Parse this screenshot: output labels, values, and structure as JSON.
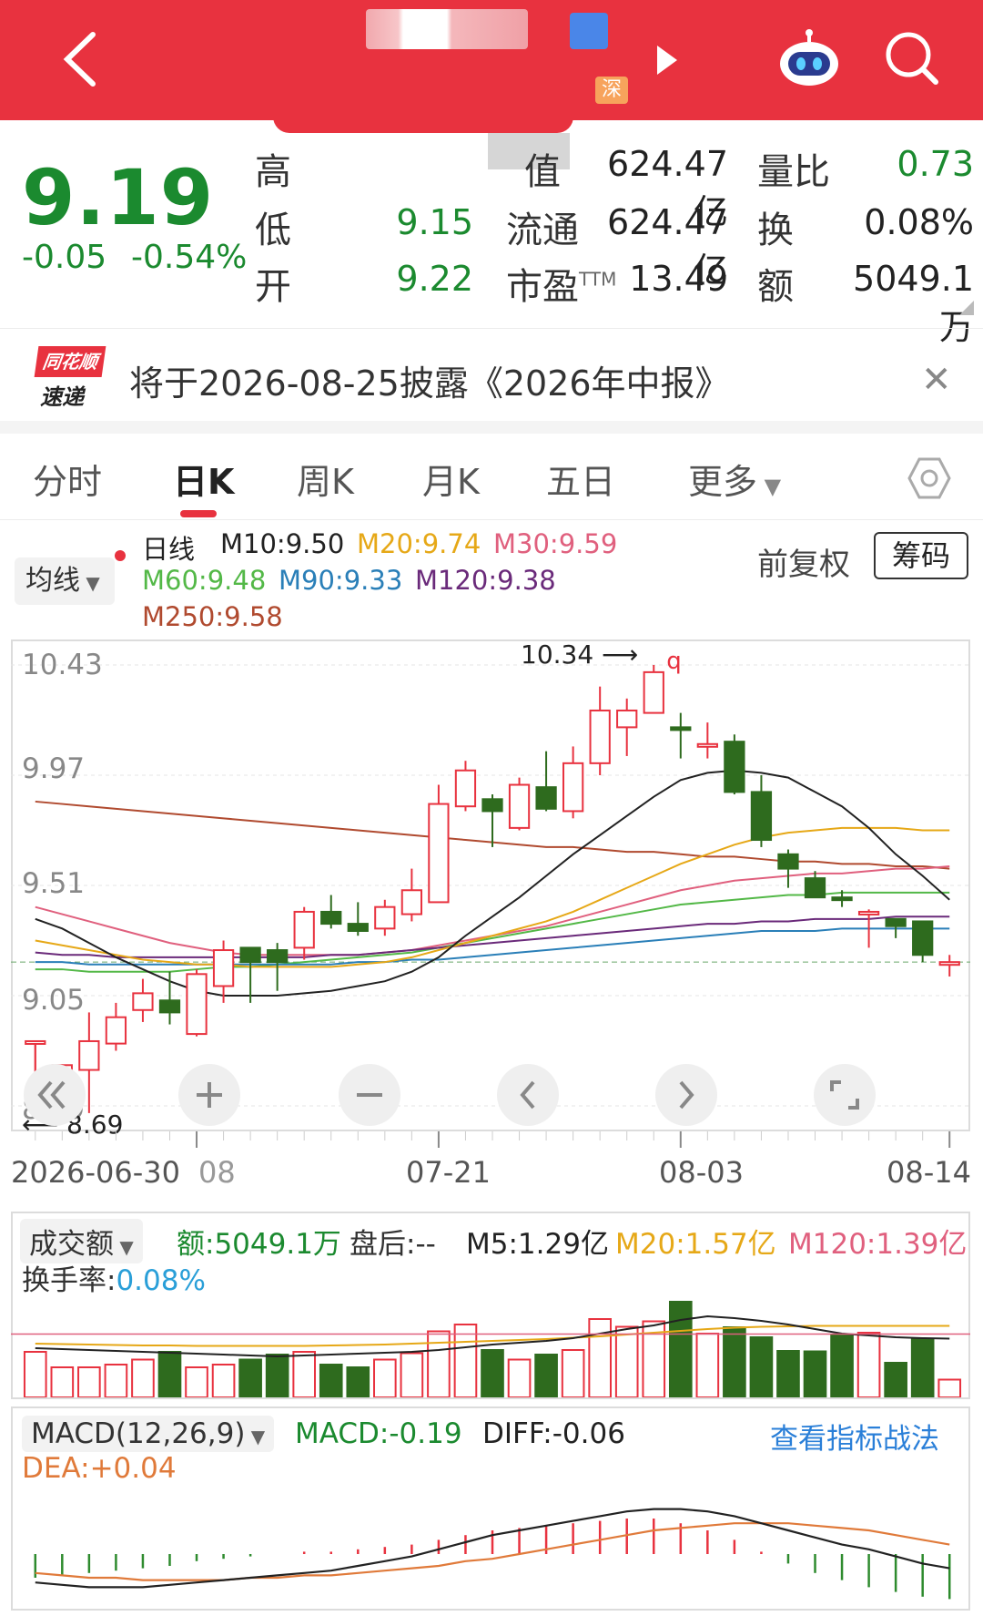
{
  "header": {
    "market_badge": "深",
    "colors": {
      "bar": "#e8323f"
    }
  },
  "quote": {
    "price": "9.19",
    "change": "-0.05",
    "change_pct": "-0.54%",
    "rows": [
      {
        "label": "高",
        "value": "",
        "label2": "值",
        "value2": "624.47亿",
        "label3": "量比",
        "value3": "0.73"
      },
      {
        "label": "低",
        "value": "9.15",
        "label2": "流通",
        "value2": "624.47亿",
        "label3": "换",
        "value3": "0.08%"
      },
      {
        "label": "开",
        "value": "9.22",
        "label2": "市盈",
        "label2_sup": "TTM",
        "value2": "13.49",
        "label3": "额",
        "value3": "5049.1万"
      }
    ]
  },
  "notice": {
    "logo_top": "同花顺",
    "logo_bottom": "速递",
    "text": "将于2026-08-25披露《2026年中报》"
  },
  "tabs": [
    "分时",
    "日K",
    "周K",
    "月K",
    "五日",
    "更多"
  ],
  "active_tab": "日K",
  "ma_legend": {
    "avg_button": "均线",
    "title": "日线",
    "items": [
      {
        "text": "M10:9.50",
        "color": "#222222"
      },
      {
        "text": "M20:9.74",
        "color": "#e6a817"
      },
      {
        "text": "M30:9.59",
        "color": "#e0607e"
      },
      {
        "text": "M60:9.48",
        "color": "#53b847"
      },
      {
        "text": "M90:9.33",
        "color": "#2a7fb8"
      },
      {
        "text": "M120:9.38",
        "color": "#6a2a7a"
      },
      {
        "text": "M250:9.58",
        "color": "#b04a2f"
      }
    ],
    "fuquan": "前复权",
    "chouma": "筹码"
  },
  "kline": {
    "y_labels": [
      "10.43",
      "9.97",
      "9.51",
      "9.05",
      "8.59"
    ],
    "high_mark": "10.34",
    "low_mark": "8.69",
    "x_labels": [
      "2026-06-30",
      "08",
      "07-21",
      "08-03",
      "08-14"
    ],
    "candles": [
      [
        8.86,
        8.86,
        8.64,
        8.54
      ],
      [
        8.66,
        8.76,
        8.62,
        8.6
      ],
      [
        8.74,
        8.86,
        8.98,
        8.56
      ],
      [
        8.85,
        8.96,
        9.02,
        8.82
      ],
      [
        8.99,
        9.06,
        9.12,
        8.94
      ],
      [
        9.03,
        8.98,
        9.15,
        8.93
      ],
      [
        8.89,
        9.14,
        9.16,
        8.88
      ],
      [
        9.09,
        9.24,
        9.28,
        9.02
      ],
      [
        9.25,
        9.19,
        9.25,
        9.02
      ],
      [
        9.24,
        9.19,
        9.27,
        9.07
      ],
      [
        9.25,
        9.4,
        9.42,
        9.2
      ],
      [
        9.4,
        9.35,
        9.47,
        9.33
      ],
      [
        9.35,
        9.32,
        9.44,
        9.3
      ],
      [
        9.33,
        9.42,
        9.45,
        9.3
      ],
      [
        9.39,
        9.49,
        9.58,
        9.36
      ],
      [
        9.44,
        9.85,
        9.93,
        9.44
      ],
      [
        9.84,
        9.99,
        10.03,
        9.82
      ],
      [
        9.87,
        9.82,
        9.89,
        9.67
      ],
      [
        9.75,
        9.93,
        9.96,
        9.74
      ],
      [
        9.92,
        9.83,
        10.07,
        9.82
      ],
      [
        9.82,
        10.02,
        10.09,
        9.79
      ],
      [
        10.02,
        10.24,
        10.34,
        9.97
      ],
      [
        10.17,
        10.24,
        10.29,
        10.05
      ],
      [
        10.23,
        10.4,
        10.43,
        10.23
      ],
      [
        10.17,
        10.16,
        10.23,
        10.04
      ],
      [
        10.1,
        10.1,
        10.19,
        10.04
      ],
      [
        10.11,
        9.9,
        10.14,
        9.89
      ],
      [
        9.9,
        9.7,
        9.97,
        9.67
      ],
      [
        9.64,
        9.58,
        9.66,
        9.5
      ],
      [
        9.54,
        9.46,
        9.57,
        9.46
      ],
      [
        9.46,
        9.45,
        9.49,
        9.42
      ],
      [
        9.4,
        9.4,
        9.41,
        9.25
      ],
      [
        9.37,
        9.34,
        9.37,
        9.29
      ],
      [
        9.36,
        9.22,
        9.36,
        9.19
      ],
      [
        9.18,
        9.19,
        9.22,
        9.13
      ]
    ],
    "ma10": [
      9.37,
      9.33,
      9.27,
      9.21,
      9.16,
      9.11,
      9.07,
      9.05,
      9.05,
      9.05,
      9.06,
      9.07,
      9.09,
      9.11,
      9.15,
      9.21,
      9.3,
      9.38,
      9.46,
      9.55,
      9.64,
      9.72,
      9.8,
      9.88,
      9.95,
      9.98,
      9.99,
      9.98,
      9.96,
      9.9,
      9.84,
      9.75,
      9.64,
      9.55,
      9.45
    ],
    "ma20": [
      9.28,
      9.26,
      9.24,
      9.22,
      9.2,
      9.19,
      9.18,
      9.18,
      9.17,
      9.17,
      9.17,
      9.17,
      9.18,
      9.19,
      9.21,
      9.24,
      9.27,
      9.3,
      9.33,
      9.36,
      9.4,
      9.45,
      9.5,
      9.55,
      9.6,
      9.64,
      9.68,
      9.71,
      9.73,
      9.74,
      9.75,
      9.75,
      9.75,
      9.74,
      9.74
    ],
    "ma30": [
      9.42,
      9.39,
      9.36,
      9.33,
      9.3,
      9.27,
      9.25,
      9.23,
      9.22,
      9.22,
      9.22,
      9.22,
      9.22,
      9.23,
      9.24,
      9.26,
      9.28,
      9.3,
      9.32,
      9.34,
      9.37,
      9.4,
      9.43,
      9.46,
      9.49,
      9.51,
      9.53,
      9.54,
      9.55,
      9.56,
      9.56,
      9.57,
      9.58,
      9.58,
      9.59
    ],
    "ma60": [
      9.16,
      9.16,
      9.15,
      9.15,
      9.15,
      9.15,
      9.16,
      9.17,
      9.17,
      9.18,
      9.19,
      9.2,
      9.21,
      9.22,
      9.23,
      9.25,
      9.27,
      9.29,
      9.31,
      9.33,
      9.35,
      9.37,
      9.39,
      9.41,
      9.43,
      9.44,
      9.45,
      9.46,
      9.47,
      9.47,
      9.48,
      9.48,
      9.48,
      9.48,
      9.48
    ],
    "ma90": [
      9.19,
      9.19,
      9.18,
      9.18,
      9.18,
      9.18,
      9.18,
      9.18,
      9.18,
      9.18,
      9.18,
      9.18,
      9.19,
      9.19,
      9.2,
      9.2,
      9.21,
      9.22,
      9.23,
      9.24,
      9.25,
      9.26,
      9.27,
      9.28,
      9.29,
      9.3,
      9.31,
      9.32,
      9.32,
      9.32,
      9.33,
      9.33,
      9.33,
      9.33,
      9.33
    ],
    "ma120": [
      9.23,
      9.22,
      9.22,
      9.21,
      9.21,
      9.21,
      9.21,
      9.21,
      9.21,
      9.21,
      9.21,
      9.22,
      9.22,
      9.23,
      9.24,
      9.25,
      9.26,
      9.27,
      9.28,
      9.29,
      9.3,
      9.31,
      9.32,
      9.33,
      9.34,
      9.35,
      9.35,
      9.36,
      9.36,
      9.37,
      9.37,
      9.37,
      9.38,
      9.38,
      9.38
    ],
    "ma250": [
      9.86,
      9.85,
      9.84,
      9.83,
      9.82,
      9.81,
      9.8,
      9.79,
      9.78,
      9.77,
      9.76,
      9.75,
      9.74,
      9.73,
      9.72,
      9.71,
      9.7,
      9.69,
      9.68,
      9.67,
      9.67,
      9.66,
      9.65,
      9.65,
      9.64,
      9.63,
      9.63,
      9.62,
      9.61,
      9.61,
      9.6,
      9.6,
      9.59,
      9.59,
      9.58
    ],
    "last_close": 9.19,
    "y_range": [
      8.59,
      10.43
    ]
  },
  "volume": {
    "selector": "成交额",
    "amount": "额:5049.1万",
    "after_hours": "盘后:--",
    "m5": "M5:1.29亿",
    "m20": "M20:1.57亿",
    "m120": "M120:1.39亿",
    "turnover_label": "换手率:",
    "turnover_value": "0.08%",
    "bars": [
      1.0,
      0.66,
      0.66,
      0.72,
      0.83,
      1.0,
      0.66,
      0.72,
      0.83,
      0.94,
      1.0,
      0.72,
      0.66,
      0.83,
      0.97,
      1.45,
      1.6,
      1.04,
      0.83,
      0.94,
      1.04,
      1.72,
      1.55,
      1.67,
      2.1,
      1.4,
      1.54,
      1.32,
      1.02,
      1.01,
      1.36,
      1.42,
      0.76,
      1.27,
      0.39
    ],
    "m5_line": [
      1.08,
      1.06,
      1.04,
      1.02,
      1.0,
      0.98,
      0.96,
      0.94,
      0.92,
      0.9,
      0.92,
      0.94,
      0.96,
      0.98,
      1.0,
      1.04,
      1.1,
      1.16,
      1.2,
      1.24,
      1.3,
      1.4,
      1.5,
      1.58,
      1.7,
      1.78,
      1.74,
      1.68,
      1.6,
      1.5,
      1.4,
      1.36,
      1.32,
      1.3,
      1.29
    ],
    "m20_line": [
      1.18,
      1.17,
      1.16,
      1.15,
      1.14,
      1.14,
      1.13,
      1.13,
      1.13,
      1.13,
      1.13,
      1.14,
      1.15,
      1.16,
      1.18,
      1.2,
      1.22,
      1.24,
      1.26,
      1.28,
      1.31,
      1.34,
      1.38,
      1.42,
      1.46,
      1.5,
      1.53,
      1.55,
      1.56,
      1.57,
      1.57,
      1.57,
      1.57,
      1.57,
      1.57
    ],
    "max": 2.2,
    "colors": {
      "up": "#e8323f",
      "down": "#2e6b1e"
    }
  },
  "macd": {
    "selector": "MACD(12,26,9)",
    "macd": "MACD:-0.19",
    "diff": "DIFF:-0.06",
    "dea": "DEA:+0.04",
    "link": "查看指标战法",
    "hist": [
      -0.1,
      -0.09,
      -0.08,
      -0.07,
      -0.06,
      -0.05,
      -0.03,
      -0.02,
      -0.01,
      0.0,
      0.01,
      0.01,
      0.02,
      0.03,
      0.04,
      0.06,
      0.08,
      0.1,
      0.11,
      0.12,
      0.13,
      0.14,
      0.15,
      0.15,
      0.13,
      0.1,
      0.06,
      0.01,
      -0.04,
      -0.08,
      -0.11,
      -0.14,
      -0.16,
      -0.18,
      -0.19
    ],
    "diff_line": [
      -0.12,
      -0.13,
      -0.14,
      -0.14,
      -0.14,
      -0.13,
      -0.12,
      -0.11,
      -0.1,
      -0.09,
      -0.08,
      -0.07,
      -0.05,
      -0.03,
      -0.01,
      0.02,
      0.05,
      0.08,
      0.1,
      0.12,
      0.14,
      0.16,
      0.18,
      0.19,
      0.19,
      0.18,
      0.16,
      0.13,
      0.1,
      0.07,
      0.04,
      0.02,
      -0.01,
      -0.04,
      -0.06
    ],
    "dea_line": [
      -0.08,
      -0.09,
      -0.1,
      -0.1,
      -0.11,
      -0.11,
      -0.11,
      -0.11,
      -0.1,
      -0.1,
      -0.09,
      -0.09,
      -0.08,
      -0.07,
      -0.06,
      -0.05,
      -0.03,
      -0.02,
      0.0,
      0.02,
      0.04,
      0.06,
      0.08,
      0.1,
      0.11,
      0.12,
      0.13,
      0.13,
      0.13,
      0.12,
      0.11,
      0.1,
      0.08,
      0.06,
      0.04
    ],
    "colors": {
      "diff": "#222222",
      "dea": "#e07a3a",
      "up": "#e8323f",
      "down": "#2e8b2e"
    }
  }
}
